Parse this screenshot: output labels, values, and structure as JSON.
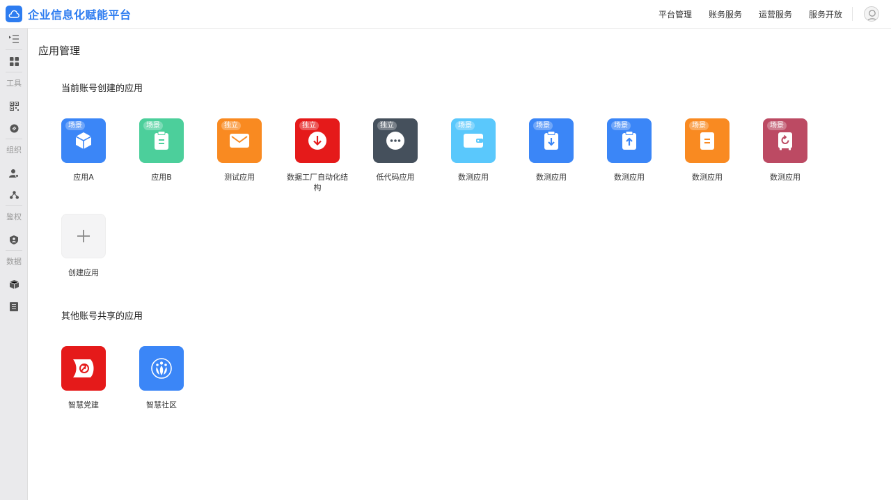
{
  "header": {
    "title": "企业信息化赋能平台",
    "nav": [
      "平台管理",
      "账务服务",
      "运营服务",
      "服务开放"
    ]
  },
  "sidebar": {
    "labels": {
      "tools": "工具",
      "org": "组织",
      "auth": "鉴权",
      "data": "数据"
    }
  },
  "main": {
    "page_title": "应用管理",
    "own_section": {
      "title": "当前账号创建的应用",
      "apps": [
        {
          "name": "应用A",
          "tag": "场景",
          "color": "#3b86f7",
          "icon": "cube-icon"
        },
        {
          "name": "应用B",
          "tag": "场景",
          "color": "#4ccf9b",
          "icon": "clipboard-icon"
        },
        {
          "name": "测试应用",
          "tag": "独立",
          "color": "#f98a21",
          "icon": "mail-icon"
        },
        {
          "name": "数据工厂自动化结构",
          "tag": "独立",
          "color": "#e51a1a",
          "icon": "download-circle-icon"
        },
        {
          "name": "低代码应用",
          "tag": "独立",
          "color": "#45505c",
          "icon": "more-circle-icon"
        },
        {
          "name": "数测应用",
          "tag": "场景",
          "color": "#5ac8fc",
          "icon": "wallet-icon"
        },
        {
          "name": "数测应用",
          "tag": "场景",
          "color": "#3b86f7",
          "icon": "clipboard-download-icon"
        },
        {
          "name": "数测应用",
          "tag": "场景",
          "color": "#3b86f7",
          "icon": "clipboard-upload-icon"
        },
        {
          "name": "数测应用",
          "tag": "场景",
          "color": "#f98a21",
          "icon": "document-icon"
        },
        {
          "name": "数测应用",
          "tag": "场景",
          "color": "#bc4a63",
          "icon": "refresh-box-icon"
        }
      ],
      "create_label": "创建应用"
    },
    "shared_section": {
      "title": "其他账号共享的应用",
      "apps": [
        {
          "name": "智慧党建",
          "color": "#e51a1a",
          "icon": "party-emblem-icon"
        },
        {
          "name": "智慧社区",
          "color": "#3b86f7",
          "icon": "community-icon"
        }
      ]
    }
  }
}
